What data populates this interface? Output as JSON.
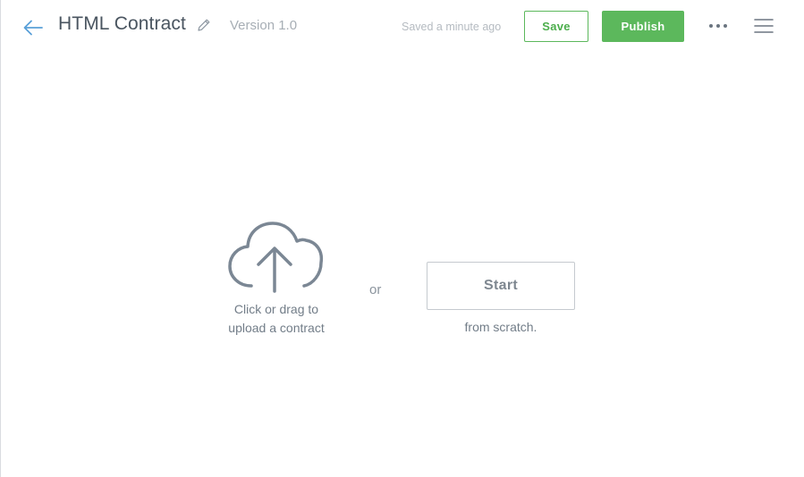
{
  "header": {
    "title": "HTML Contract",
    "version": "Version 1.0",
    "saved_status": "Saved a minute ago",
    "save_label": "Save",
    "publish_label": "Publish",
    "icons": {
      "back": "arrow-left-icon",
      "edit": "pencil-icon",
      "more": "more-horizontal-icon",
      "menu": "hamburger-menu-icon"
    }
  },
  "main": {
    "upload": {
      "icon": "cloud-upload-icon",
      "line1": "Click or drag to",
      "line2": "upload a contract"
    },
    "or_text": "or",
    "start_label": "Start",
    "scratch_text": "from scratch."
  },
  "colors": {
    "accent_blue": "#5aa0d8",
    "green": "#5cb85c",
    "icon_gray": "#7b8794"
  }
}
